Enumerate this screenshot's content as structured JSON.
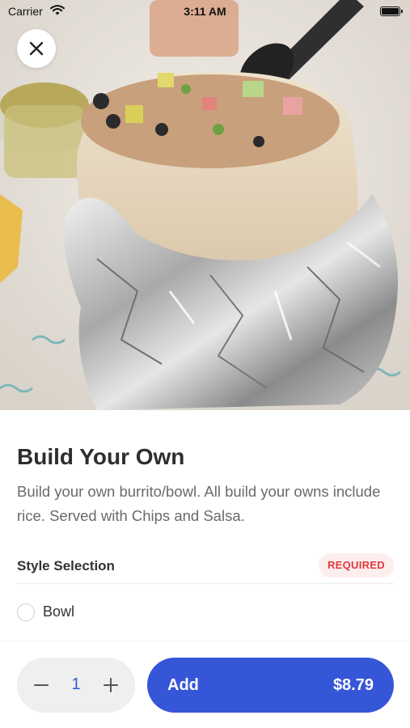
{
  "status_bar": {
    "carrier": "Carrier",
    "time": "3:11 AM",
    "icons": [
      "wifi-icon",
      "battery-icon"
    ]
  },
  "hero": {
    "image": "burrito-in-foil-photo",
    "close_icon": "close-icon"
  },
  "item": {
    "title": "Build Your Own",
    "description": "Build your own burrito/bowl. All build your owns include rice. Served with Chips and Salsa."
  },
  "style_selection": {
    "title": "Style Selection",
    "badge": "REQUIRED",
    "options": [
      {
        "label": "Bowl",
        "selected": false
      }
    ]
  },
  "bottom_bar": {
    "quantity": "1",
    "minus_icon": "minus-icon",
    "plus_icon": "plus-icon",
    "add_label": "Add",
    "price": "$8.79"
  },
  "colors": {
    "accent": "#3656d8",
    "required_text": "#e0383e",
    "required_bg": "#fdeeee",
    "stepper_bg": "#efefef"
  }
}
